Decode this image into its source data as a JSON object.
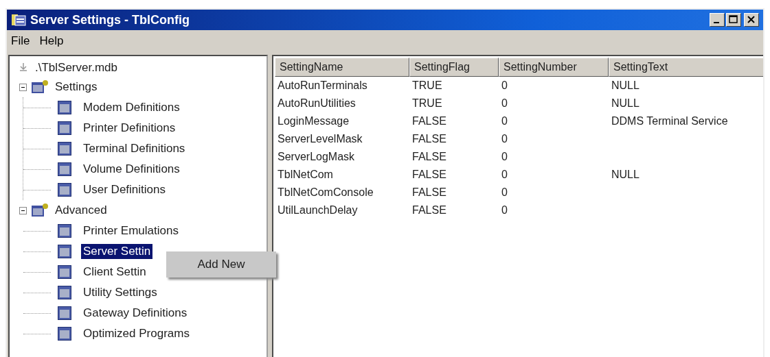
{
  "window": {
    "title": "Server Settings - TblConfig"
  },
  "menu": [
    "File",
    "Help"
  ],
  "tree": {
    "label": ".\\TblServer.mdb",
    "selected": false,
    "children": [
      {
        "label": "Settings",
        "kind": "folder",
        "expanded": true,
        "selected": false,
        "children": [
          {
            "label": "Modem Definitions",
            "kind": "table",
            "selected": false
          },
          {
            "label": "Printer Definitions",
            "kind": "table",
            "selected": false
          },
          {
            "label": "Terminal Definitions",
            "kind": "table",
            "selected": false
          },
          {
            "label": "Volume Definitions",
            "kind": "table",
            "selected": false
          },
          {
            "label": "User Definitions",
            "kind": "table",
            "selected": false
          }
        ]
      },
      {
        "label": "Advanced",
        "kind": "folder",
        "expanded": true,
        "selected": false,
        "children": [
          {
            "label": "Printer Emulations",
            "kind": "table",
            "selected": false
          },
          {
            "label": "Server Settin",
            "kind": "table",
            "selected": true
          },
          {
            "label": "Client Settin",
            "kind": "table",
            "selected": false
          },
          {
            "label": "Utility Settings",
            "kind": "table",
            "selected": false
          },
          {
            "label": "Gateway Definitions",
            "kind": "table",
            "selected": false
          },
          {
            "label": "Optimized Programs",
            "kind": "table",
            "selected": false
          }
        ]
      }
    ]
  },
  "context_menu": {
    "items": [
      "Add New"
    ]
  },
  "table": {
    "columns": [
      "SettingName",
      "SettingFlag",
      "SettingNumber",
      "SettingText"
    ],
    "rows": [
      [
        "AutoRunTerminals",
        "TRUE",
        "0",
        "NULL"
      ],
      [
        "AutoRunUtilities",
        "TRUE",
        "0",
        "NULL"
      ],
      [
        "LoginMessage",
        "FALSE",
        "0",
        "DDMS Terminal Service"
      ],
      [
        "ServerLevelMask",
        "FALSE",
        "0",
        ""
      ],
      [
        "ServerLogMask",
        "FALSE",
        "0",
        ""
      ],
      [
        "TblNetCom",
        "FALSE",
        "0",
        "NULL"
      ],
      [
        "TblNetComConsole",
        "FALSE",
        "0",
        ""
      ],
      [
        "UtilLaunchDelay",
        "FALSE",
        "0",
        ""
      ]
    ]
  }
}
